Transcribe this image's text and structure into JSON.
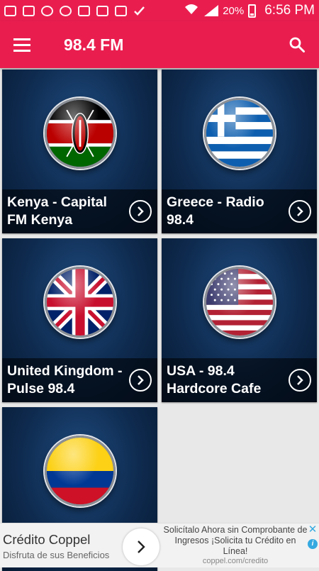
{
  "status_bar": {
    "battery_percent": "20%",
    "time": "6:56 PM",
    "icons": [
      "message-icon",
      "phone-alert-icon",
      "sync-icon",
      "shield-icon",
      "image-icon",
      "mail-icon",
      "youtube-icon",
      "check-icon",
      "wifi-icon",
      "signal-icon",
      "battery-icon"
    ]
  },
  "app_bar": {
    "title": "98.4 FM",
    "menu_icon": "hamburger-menu-icon",
    "search_icon": "search-icon",
    "color": "#e91e4f"
  },
  "stations": [
    {
      "label": "Kenya - Capital\nFM Kenya",
      "flag": "kenya-flag-icon"
    },
    {
      "label": "Greece - Radio\n98.4",
      "flag": "greece-flag-icon"
    },
    {
      "label": "United Kingdom -\nPulse 98.4",
      "flag": "uk-flag-icon"
    },
    {
      "label": "USA - 98.4\nHardcore Cafe",
      "flag": "usa-flag-icon"
    },
    {
      "label": "",
      "flag": "colombia-flag-icon"
    }
  ],
  "ad": {
    "title": "Crédito Coppel",
    "subtitle": "Disfruta de sus Beneficios",
    "description": "Solicítalo Ahora sin Comprobante de Ingresos ¡Solicita tu Crédito en Línea!",
    "url": "coppel.com/credito",
    "accent_color": "#35a9e0"
  }
}
